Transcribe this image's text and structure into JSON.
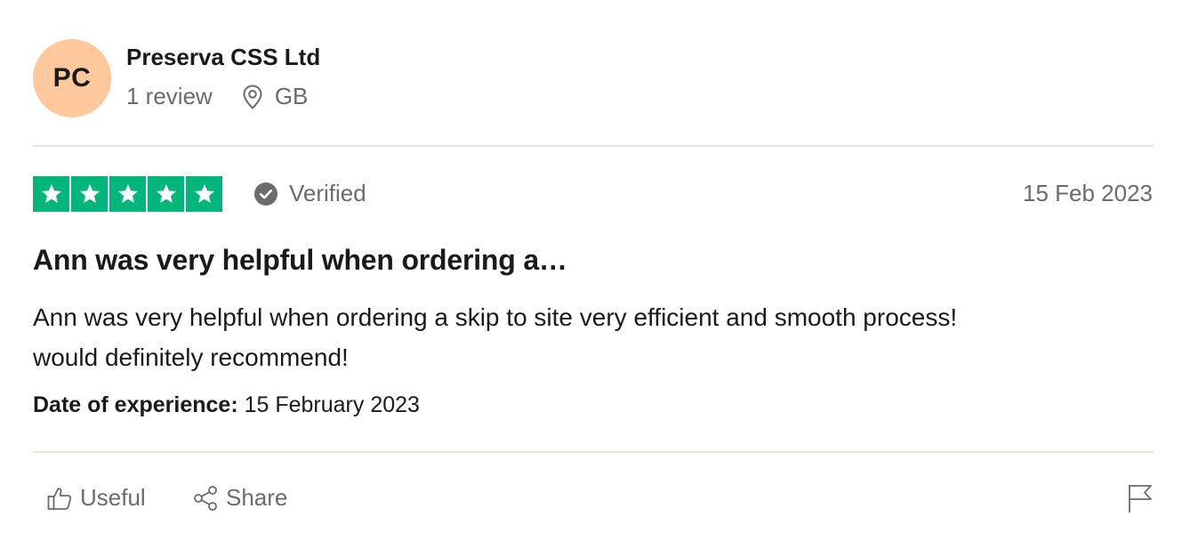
{
  "reviewer": {
    "initials": "PC",
    "name": "Preserva CSS Ltd",
    "review_count": "1 review",
    "location": "GB",
    "location_icon": "location-pin-icon",
    "avatar_color": "#ffc99d"
  },
  "review": {
    "rating": 5,
    "max_rating": 5,
    "star_color": "#00b67a",
    "verified_label": "Verified",
    "verified_icon": "check-circle-icon",
    "date": "15 Feb 2023",
    "title": "Ann was very helpful when ordering a…",
    "body_line1": "Ann was very helpful when ordering a skip to site very efficient and smooth process!",
    "body_line2": "would definitely recommend!",
    "experience_label": "Date of experience:",
    "experience_date": "15 February 2023"
  },
  "actions": {
    "useful_label": "Useful",
    "useful_icon": "thumbs-up-icon",
    "share_label": "Share",
    "share_icon": "share-icon",
    "report_icon": "flag-icon"
  }
}
